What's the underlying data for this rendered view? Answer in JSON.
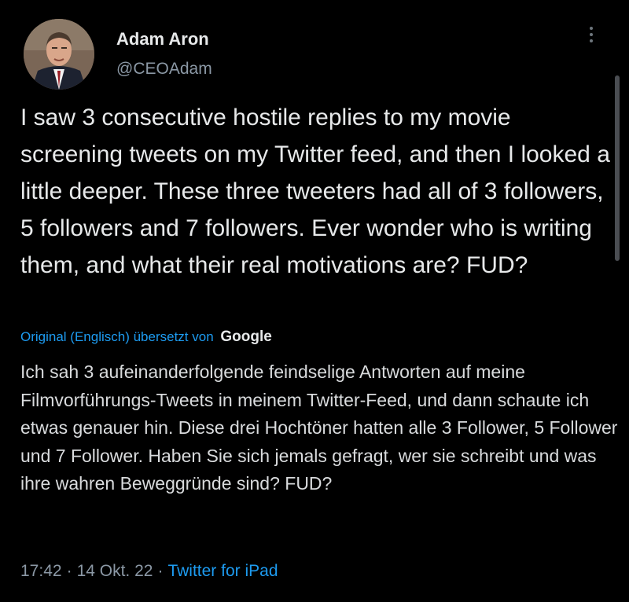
{
  "author": {
    "display_name": "Adam Aron",
    "handle": "@CEOAdam"
  },
  "tweet": {
    "text": "I saw 3 consecutive hostile replies to my movie screening tweets on my Twitter feed, and then I looked a little deeper. These three tweeters had all of 3 followers, 5 followers and 7 followers. Ever wonder who is writing them, and what their real motivations are? FUD?",
    "translation_credit": "Original (Englisch) übersetzt von",
    "translation_provider": "Google",
    "translated_text": "Ich sah 3 aufeinanderfolgende feindselige Antworten auf meine Filmvorführungs-Tweets in meinem Twitter-Feed, und dann schaute ich etwas genauer hin. Diese drei Hochtöner hatten alle 3 Follower, 5 Follower und 7 Follower. Haben Sie sich jemals gefragt, wer sie schreibt und was ihre wahren Beweggründe sind? FUD?"
  },
  "meta": {
    "time": "17:42",
    "date": "14 Okt. 22",
    "source": "Twitter for iPad",
    "separator": "·"
  },
  "icons": {
    "more": "more-vertical-icon",
    "avatar": "profile-photo"
  },
  "colors": {
    "background": "#000000",
    "text": "#e7e9ea",
    "secondary": "#8b98a5",
    "link": "#1d9bf0"
  }
}
